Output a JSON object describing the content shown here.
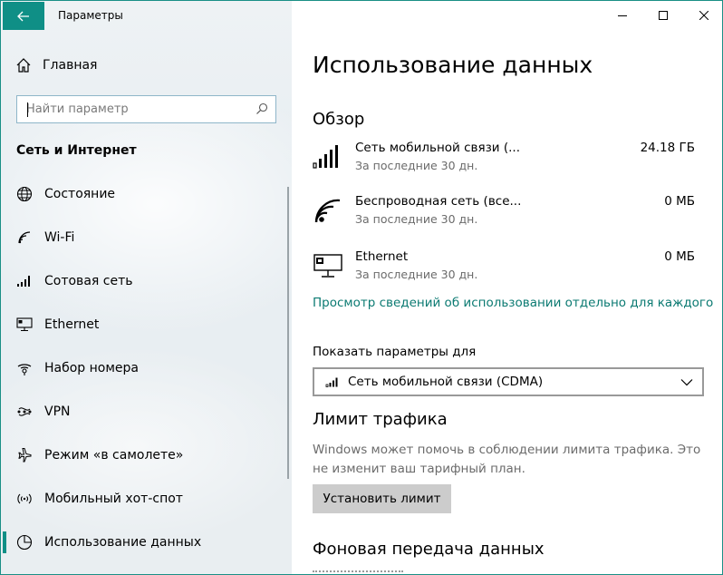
{
  "app": {
    "title": "Параметры",
    "accent": "#0f8f86"
  },
  "sidebar": {
    "home_label": "Главная",
    "search_placeholder": "Найти параметр",
    "section_title": "Сеть и Интернет",
    "items": [
      {
        "label": "Состояние",
        "icon": "globe-icon"
      },
      {
        "label": "Wi-Fi",
        "icon": "wifi-icon"
      },
      {
        "label": "Сотовая сеть",
        "icon": "cellular-icon"
      },
      {
        "label": "Ethernet",
        "icon": "ethernet-icon"
      },
      {
        "label": "Набор номера",
        "icon": "dialup-icon"
      },
      {
        "label": "VPN",
        "icon": "vpn-icon"
      },
      {
        "label": "Режим «в самолете»",
        "icon": "airplane-icon"
      },
      {
        "label": "Мобильный хот-спот",
        "icon": "hotspot-icon"
      },
      {
        "label": "Использование данных",
        "icon": "data-usage-icon",
        "active": true
      }
    ]
  },
  "main": {
    "title": "Использование данных",
    "overview_heading": "Обзор",
    "overview": [
      {
        "name": "Сеть мобильной связи (...",
        "period": "За последние 30 дн.",
        "value": "24.18 ГБ",
        "icon": "cellular-signal-icon"
      },
      {
        "name": "Беспроводная сеть (все...",
        "period": "За последние 30 дн.",
        "value": "0 МБ",
        "icon": "wifi-icon"
      },
      {
        "name": "Ethernet",
        "period": "За последние 30 дн.",
        "value": "0 МБ",
        "icon": "ethernet-icon"
      }
    ],
    "details_link": "Просмотр сведений об использовании отдельно для каждого",
    "show_settings_label": "Показать параметры для",
    "network_select": "Сеть мобильной связи (CDMA)",
    "limit_heading": "Лимит трафика",
    "limit_description": "Windows может помочь в соблюдении лимита трафика. Это не изменит ваш тарифный план.",
    "set_limit_button": "Установить лимит",
    "background_heading": "Фоновая передача данных"
  }
}
